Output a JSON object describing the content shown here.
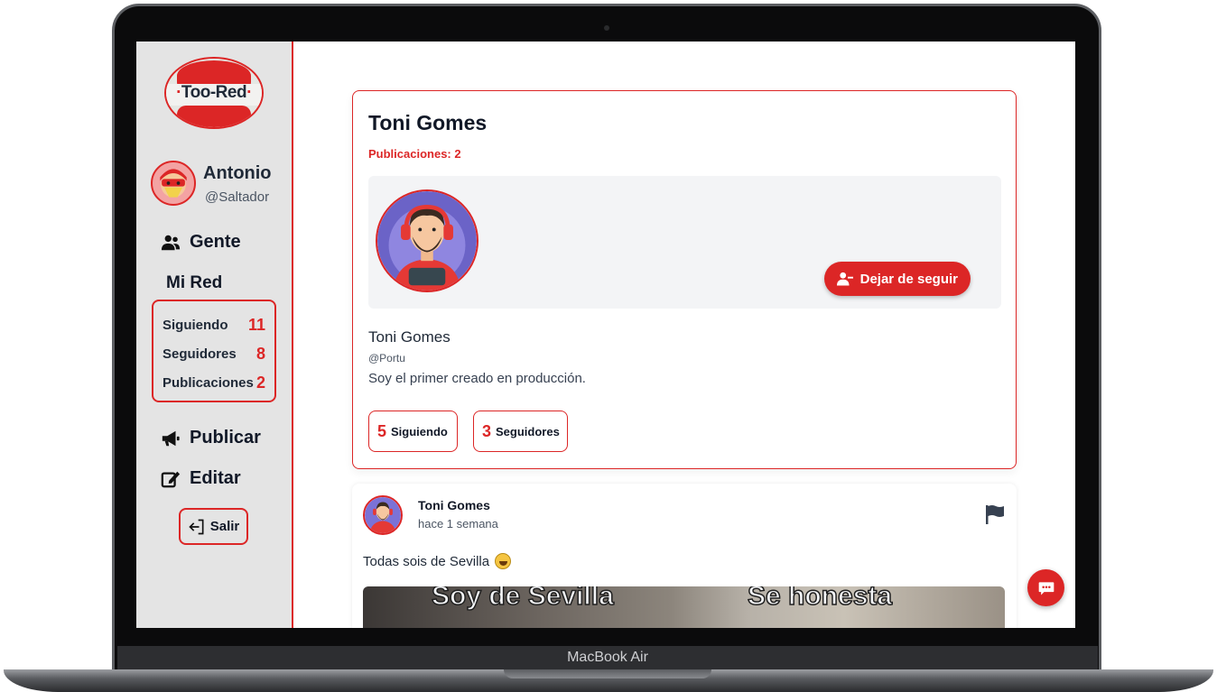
{
  "device": {
    "label": "MacBook Air"
  },
  "logo": {
    "text_left": "Too",
    "text_sep": "-",
    "text_right": "Red"
  },
  "current_user": {
    "name": "Antonio",
    "handle": "@Saltador"
  },
  "nav": {
    "gente": "Gente",
    "mi_red_title": "Mi Red",
    "publicar": "Publicar",
    "editar": "Editar",
    "salir": "Salir"
  },
  "mi_red": [
    {
      "label": "Siguiendo",
      "value": "11"
    },
    {
      "label": "Seguidores",
      "value": "8"
    },
    {
      "label": "Publicaciones",
      "value": "2"
    }
  ],
  "profile": {
    "name": "Toni Gomes",
    "publications_label": "Publicaciones: 2",
    "follow_button": "Dejar de seguir",
    "full_name": "Toni Gomes",
    "handle": "@Portu",
    "bio": "Soy el primer creado en producción.",
    "following_count": "5",
    "following_label": "Siguiendo",
    "followers_count": "3",
    "followers_label": "Seguidores"
  },
  "post": {
    "author": "Toni Gomes",
    "time": "hace 1 semana",
    "text": "Todas sois de Sevilla",
    "media_caption_left": "Soy de Sevilla",
    "media_caption_right": "Se honesta"
  },
  "colors": {
    "accent": "#dc2626",
    "sidebar_bg": "#e4e4e4"
  },
  "icons": [
    "users-icon",
    "bullhorn-icon",
    "edit-icon",
    "sign-out-icon",
    "user-minus-icon",
    "flag-icon",
    "chat-icon"
  ]
}
